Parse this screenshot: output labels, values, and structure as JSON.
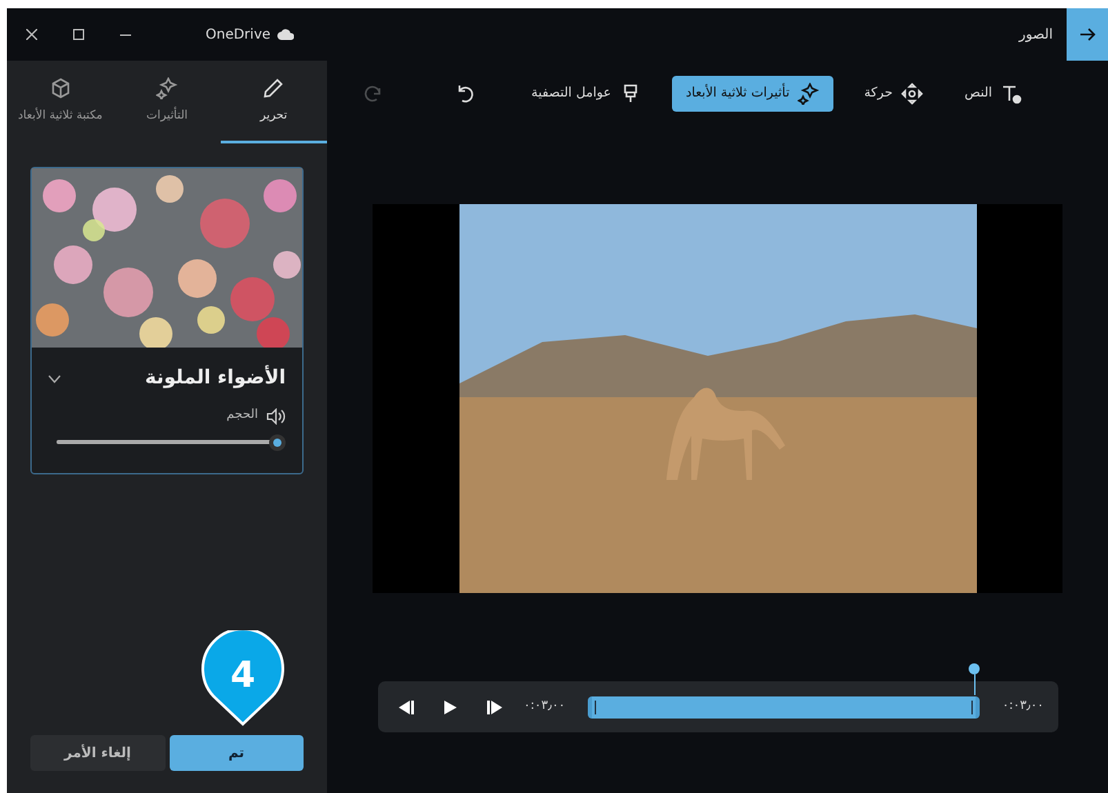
{
  "window": {
    "cloud_label": "OneDrive",
    "title": "الصور"
  },
  "side_tabs": [
    {
      "label": "تحرير",
      "kind": "pencil",
      "selected": true
    },
    {
      "label": "التأثيرات",
      "kind": "sparkle",
      "selected": false
    },
    {
      "label": "مكتبة ثلاثية الأبعاد",
      "kind": "cube",
      "selected": false
    }
  ],
  "effect_card": {
    "title": "الأضواء الملونة",
    "volume_label": "الحجم",
    "level": 1
  },
  "callout": {
    "number": "4"
  },
  "buttons": [
    {
      "label": "تم",
      "kind": "primary"
    },
    {
      "label": "إلغاء الأمر",
      "kind": "secondary"
    }
  ],
  "toolbar": [
    {
      "label": "النص",
      "kind": "text",
      "selected": false,
      "disabled": false
    },
    {
      "label": "حركة",
      "kind": "motion",
      "selected": false,
      "disabled": false
    },
    {
      "label": "تأثيرات ثلاثية الأبعاد",
      "kind": "effects3d",
      "selected": true,
      "disabled": false
    },
    {
      "label": "عوامل التصفية",
      "kind": "filter",
      "selected": false,
      "disabled": false
    },
    {
      "kind": "undo",
      "selected": false,
      "disabled": false
    },
    {
      "kind": "redo",
      "selected": false,
      "disabled": true
    }
  ],
  "timeline": {
    "end_time": "٠:٠٣٫٠٠",
    "start_time": "٠:٠٣٫٠٠",
    "level": 1
  }
}
